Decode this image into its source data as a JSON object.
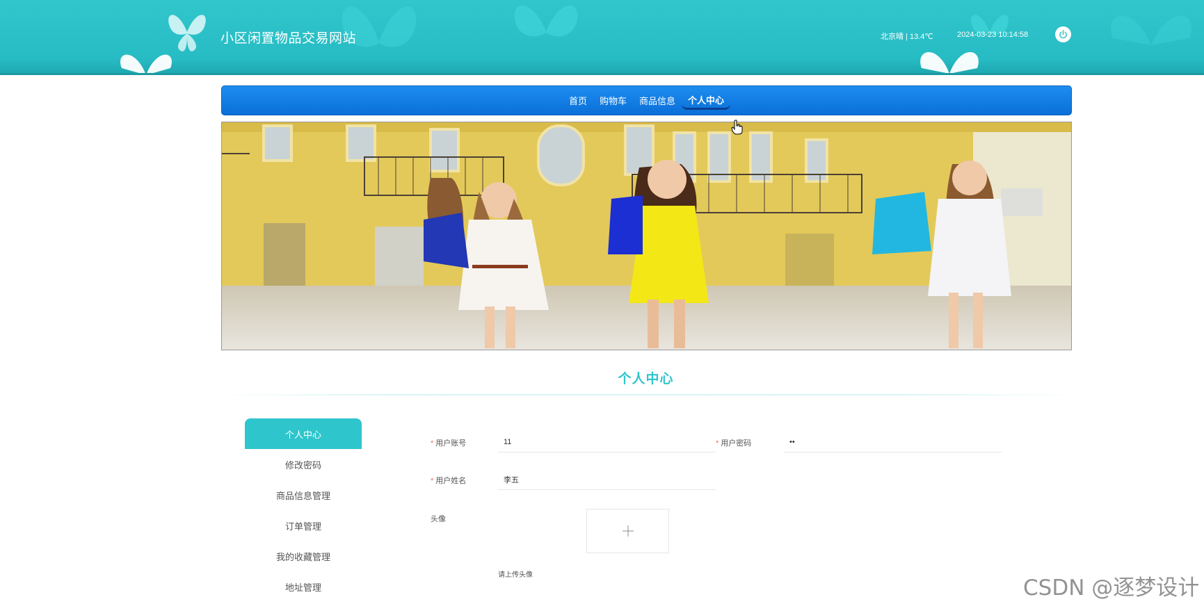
{
  "header": {
    "site_title": "小区闲置物品交易网站",
    "weather": "北京晴 | 13.4℃",
    "datetime": "2024-03-23 10:14:58",
    "power_icon": "power-icon"
  },
  "nav": {
    "items": [
      {
        "label": "首页"
      },
      {
        "label": "购物车"
      },
      {
        "label": "商品信息"
      },
      {
        "label": "个人中心"
      }
    ],
    "active_index": 3
  },
  "banner": {
    "description_icon": "banner-image"
  },
  "section": {
    "title": "个人中心"
  },
  "sidebar": {
    "items": [
      {
        "label": "个人中心"
      },
      {
        "label": "修改密码"
      },
      {
        "label": "商品信息管理"
      },
      {
        "label": "订单管理"
      },
      {
        "label": "我的收藏管理"
      },
      {
        "label": "地址管理"
      }
    ],
    "active_index": 0
  },
  "form": {
    "account_label": "用户账号",
    "account_value": "11",
    "password_label": "用户密码",
    "password_value": "••",
    "name_label": "用户姓名",
    "name_value": "李五",
    "avatar_label": "头像",
    "upload_hint": "请上传头像",
    "required_mark": "*"
  },
  "watermark": "CSDN @逐梦设计",
  "colors": {
    "header_teal": "#2ec5cc",
    "nav_blue": "#0a6fd8",
    "accent": "#2ec5cc",
    "required": "#f56c6c"
  }
}
